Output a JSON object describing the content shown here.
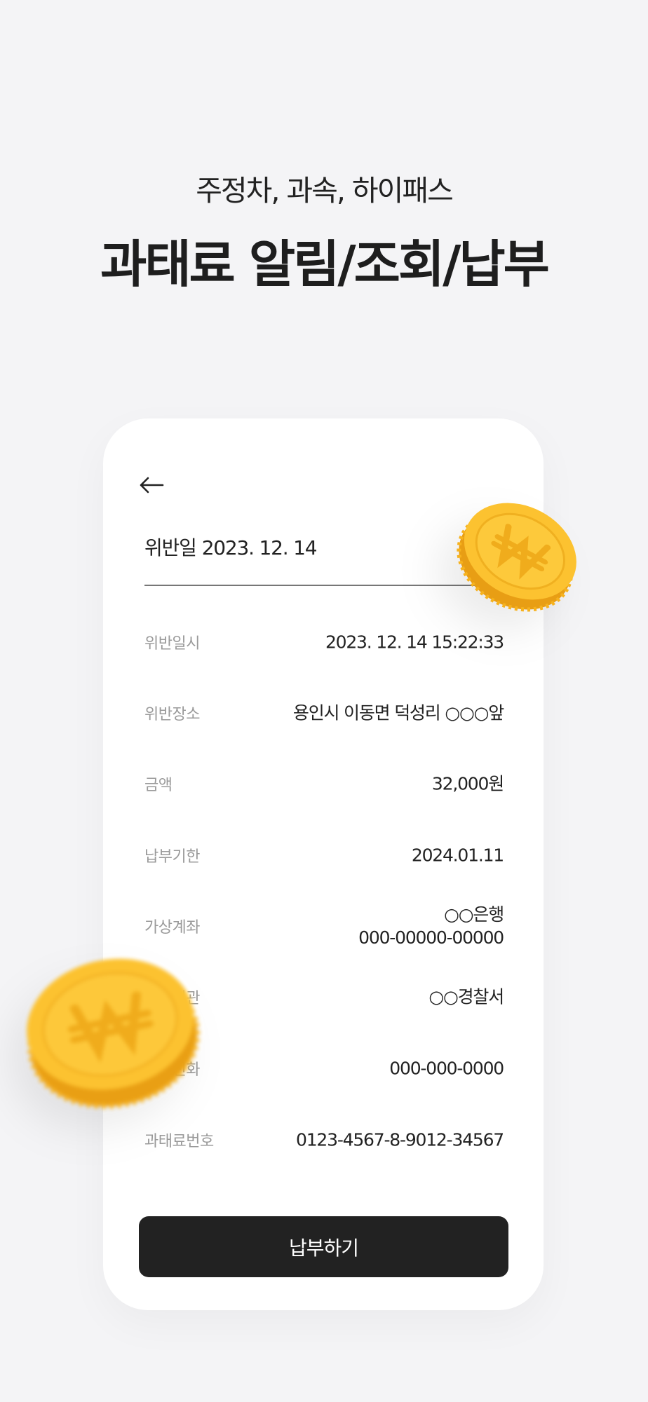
{
  "headline": {
    "subtitle": "주정차, 과속, 하이패스",
    "title": "과태료 알림/조회/납부"
  },
  "detail": {
    "back_icon": "arrow-left-icon",
    "violation_date_label": "위반일",
    "violation_date_value": "2023. 12. 14",
    "rows": [
      {
        "label": "위반일시",
        "value": "2023. 12. 14 15:22:33"
      },
      {
        "label": "위반장소",
        "value": "용인시 이동면 덕성리  ○○○앞"
      },
      {
        "label": "금액",
        "value": "32,000원"
      },
      {
        "label": "납부기한",
        "value": "2024.01.11"
      },
      {
        "label": "가상계좌",
        "value_line1": "○○은행",
        "value_line2": "000-00000-00000"
      },
      {
        "label": "부과기관",
        "value": "○○경찰서"
      },
      {
        "label": "기관전화",
        "value": "000-000-0000"
      },
      {
        "label": "과태료번호",
        "value": "0123-4567-8-9012-34567"
      }
    ],
    "pay_button_label": "납부하기"
  },
  "colors": {
    "background": "#f4f4f6",
    "card": "#ffffff",
    "button": "#222222",
    "coin": "#fcc230"
  },
  "icons": [
    "arrow-left-icon",
    "won-coin-icon"
  ]
}
